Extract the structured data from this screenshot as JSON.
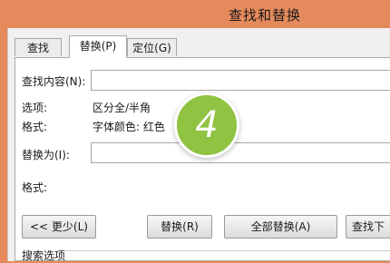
{
  "window": {
    "title": "查找和替换"
  },
  "tabs": [
    {
      "label": "查找(D)"
    },
    {
      "label": "替换(P)",
      "active": true
    },
    {
      "label": "定位(G)"
    }
  ],
  "find": {
    "label": "查找内容(N):",
    "value": ""
  },
  "options": {
    "label": "选项:",
    "value": "区分全/半角"
  },
  "find_format": {
    "label": "格式:",
    "value": "字体颜色: 红色"
  },
  "replace": {
    "label": "替换为(I):",
    "value": ""
  },
  "replace_format": {
    "label": "格式:",
    "value": ""
  },
  "buttons": {
    "less": "<< 更少(L)",
    "replace": "替换(R)",
    "replace_all": "全部替换(A)",
    "find_next": "查找下"
  },
  "search_options": {
    "label": "搜索选项"
  },
  "badge": {
    "number": "4",
    "color": "#8fc341"
  }
}
